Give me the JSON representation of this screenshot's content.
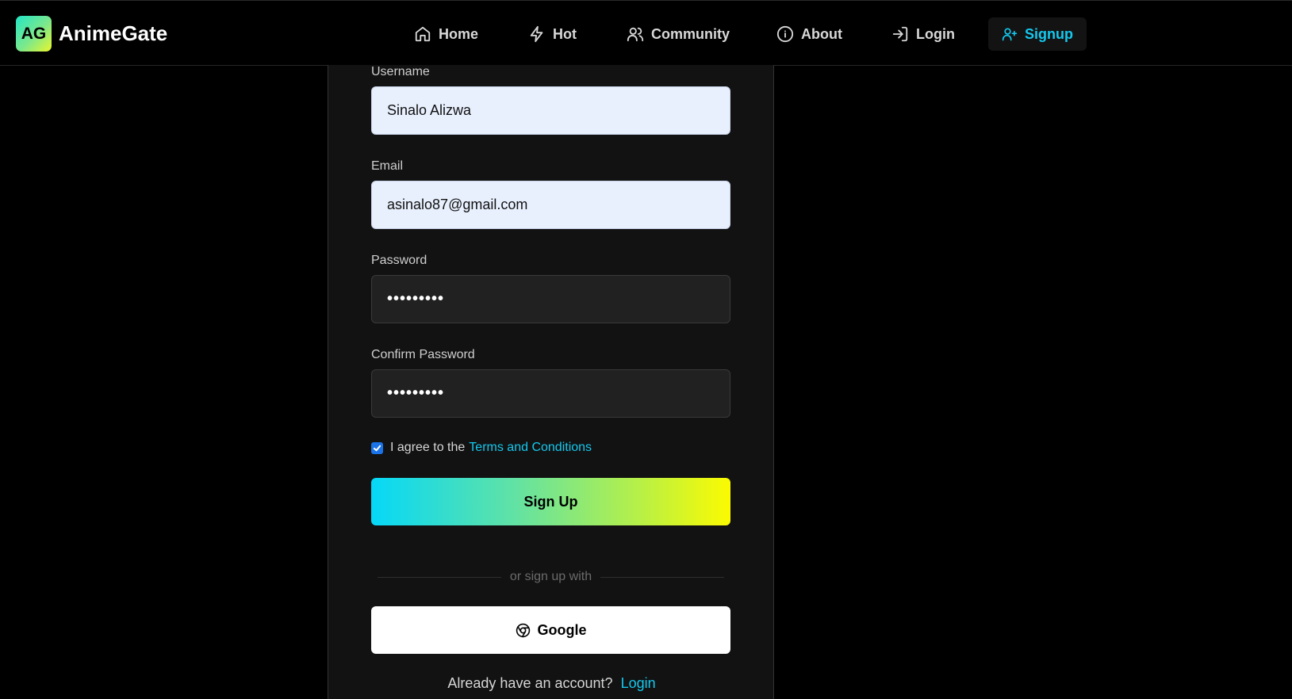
{
  "brand": {
    "logo_text": "AG",
    "name": "AnimeGate"
  },
  "nav": {
    "items": [
      {
        "label": "Home",
        "icon": "home-icon"
      },
      {
        "label": "Hot",
        "icon": "lightning-icon"
      },
      {
        "label": "Community",
        "icon": "users-icon"
      },
      {
        "label": "About",
        "icon": "info-icon"
      },
      {
        "label": "Login",
        "icon": "login-icon"
      },
      {
        "label": "Signup",
        "icon": "user-plus-icon",
        "active": true
      }
    ]
  },
  "form": {
    "username": {
      "label": "Username",
      "value": "Sinalo Alizwa"
    },
    "email": {
      "label": "Email",
      "value": "asinalo87@gmail.com"
    },
    "password": {
      "label": "Password",
      "value": "•••••••••"
    },
    "confirm_password": {
      "label": "Confirm Password",
      "value": "•••••••••"
    },
    "agree": {
      "text": "I agree to the",
      "link": "Terms and Conditions",
      "checked": true
    },
    "submit_label": "Sign Up",
    "divider_text": "or sign up with",
    "google_label": "Google",
    "footer_text": "Already have an account?",
    "footer_link": "Login"
  },
  "colors": {
    "accent": "#14c8ee",
    "gradient_start": "#05d8f8",
    "gradient_end": "#fbfb00",
    "background": "#000000",
    "card": "#121212"
  }
}
